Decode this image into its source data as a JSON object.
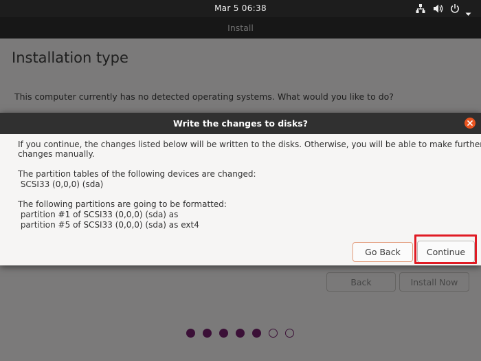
{
  "system_bar": {
    "clock": "Mar 5  06:38",
    "icons": [
      "network-icon",
      "volume-icon",
      "power-icon",
      "chevron-down-icon"
    ]
  },
  "window": {
    "title": "Install",
    "page_title": "Installation type",
    "question": "This computer currently has no detected operating systems. What would you like to do?",
    "back_label": "Back",
    "install_now_label": "Install Now",
    "progress": {
      "total": 7,
      "completed": 5
    }
  },
  "dialog": {
    "title": "Write the changes to disks?",
    "intro_line1": "If you continue, the changes listed below will be written to the disks. Otherwise, you will be able to make further",
    "intro_line2": "changes manually.",
    "tables_heading": "The partition tables of the following devices are changed:",
    "tables_device": " SCSI33 (0,0,0) (sda)",
    "partitions_heading": "The following partitions are going to be formatted:",
    "partitions": [
      " partition #1 of SCSI33 (0,0,0) (sda) as",
      " partition #5 of SCSI33 (0,0,0) (sda) as ext4"
    ],
    "go_back_label": "Go Back",
    "continue_label": "Continue"
  },
  "colors": {
    "ubuntu_orange": "#e95420",
    "aubergine": "#77216f",
    "highlight_red": "#e01b24"
  }
}
